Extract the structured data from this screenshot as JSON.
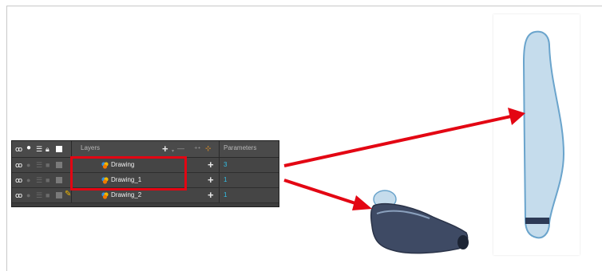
{
  "header": {
    "layers_label": "Layers",
    "parameters_label": "Parameters"
  },
  "icons": {
    "header": [
      "eye-pair-icon",
      "circle-icon",
      "list-icon",
      "lock-icon",
      "white-square-icon"
    ],
    "add_layer": "plus-icon",
    "remove_layer": "minus-icon",
    "add_peg": "peg-icon",
    "add_drawing": "drawing-add-icon"
  },
  "layers": [
    {
      "name": "Drawing",
      "param": "3"
    },
    {
      "name": "Drawing_1",
      "param": "1"
    },
    {
      "name": "Drawing_2",
      "param": "1"
    }
  ],
  "colors": {
    "highlight": "#e30613",
    "param_text": "#33c0e8",
    "panel_bg": "#3d3d3d",
    "drawing_fill": "#c5dcec",
    "shoe_fill": "#3e4a64"
  }
}
